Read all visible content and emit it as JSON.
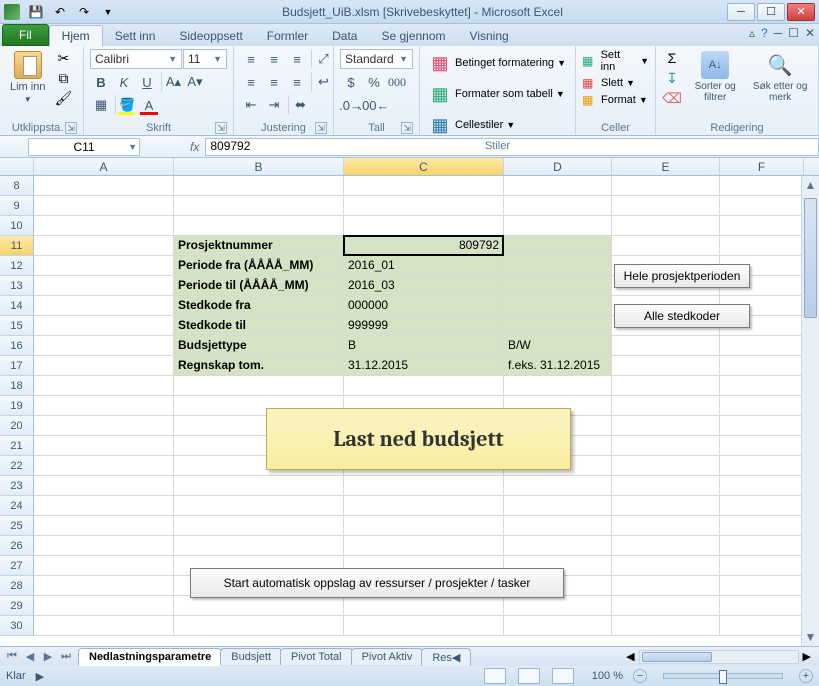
{
  "title": "Budsjett_UiB.xlsm  [Skrivebeskyttet] - Microsoft Excel",
  "tabs": {
    "file": "Fil",
    "home": "Hjem",
    "insert": "Sett inn",
    "layout": "Sideoppsett",
    "formulas": "Formler",
    "data": "Data",
    "review": "Se gjennom",
    "view": "Visning"
  },
  "ribbon": {
    "clipboard": {
      "paste": "Lim inn",
      "label": "Utklippsta…"
    },
    "font": {
      "name": "Calibri",
      "size": "11",
      "label": "Skrift"
    },
    "alignment": {
      "label": "Justering"
    },
    "number": {
      "format": "Standard",
      "label": "Tall"
    },
    "styles": {
      "cond": "Betinget formatering",
      "table": "Formater som tabell",
      "cell": "Cellestiler",
      "label": "Stiler"
    },
    "cells": {
      "insert": "Sett inn",
      "delete": "Slett",
      "format": "Format",
      "label": "Celler"
    },
    "editing": {
      "sort": "Sorter og filtrer",
      "find": "Søk etter og merk",
      "label": "Redigering"
    }
  },
  "namebox": "C11",
  "formula": "809792",
  "columns": [
    "A",
    "B",
    "C",
    "D",
    "E",
    "F"
  ],
  "rowstart": 8,
  "rowend": 30,
  "form": {
    "prosjektnummer_label": "Prosjektnummer",
    "prosjektnummer_value": "809792",
    "periode_fra_label": "Periode fra (ÅÅÅÅ_MM)",
    "periode_fra_value": "2016_01",
    "periode_til_label": "Periode til (ÅÅÅÅ_MM)",
    "periode_til_value": "2016_03",
    "stedkode_fra_label": "Stedkode fra",
    "stedkode_fra_value": "000000",
    "stedkode_til_label": "Stedkode til",
    "stedkode_til_value": "999999",
    "budsjettype_label": "Budsjettype",
    "budsjettype_value": "B",
    "budsjettype_hint": "B/W",
    "regnskap_label": "Regnskap tom.",
    "regnskap_value": "31.12.2015",
    "regnskap_hint": "f.eks. 31.12.2015"
  },
  "buttons": {
    "hele": "Hele prosjektperioden",
    "alle": "Alle stedkoder",
    "last": "Last ned budsjett",
    "start": "Start automatisk oppslag av ressurser / prosjekter / tasker"
  },
  "sheettabs": {
    "active": "Nedlastningsparametre",
    "t2": "Budsjett",
    "t3": "Pivot Total",
    "t4": "Pivot Aktiv",
    "t5": "Res"
  },
  "status": {
    "ready": "Klar",
    "zoom": "100 %"
  }
}
